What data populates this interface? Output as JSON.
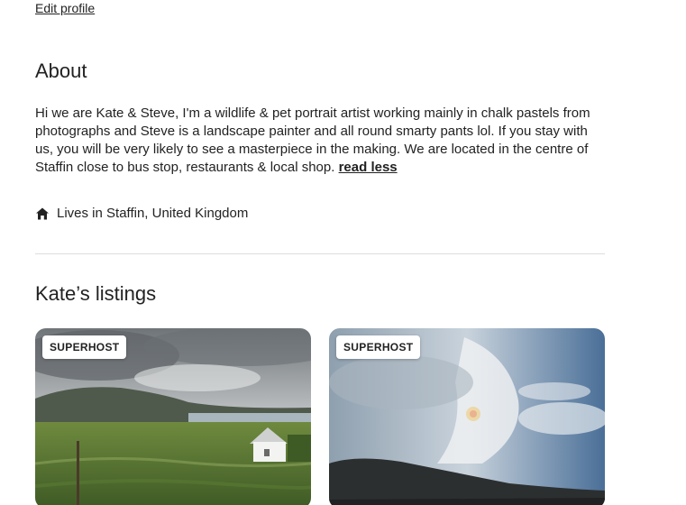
{
  "profile": {
    "edit_label": "Edit profile"
  },
  "about": {
    "heading": "About",
    "bio": "Hi we are Kate & Steve, I'm a wildlife & pet portrait artist working mainly in chalk pastels from photographs and Steve is a landscape painter and all round smarty pants lol. If you stay with us, you will be very likely to see a masterpiece in the making. We are located in the centre of Staffin close to bus stop, restaurants & local shop.",
    "read_less_label": "read less",
    "lives_in": "Lives in Staffin, United Kingdom",
    "lives_icon": "home-icon"
  },
  "listings": {
    "heading": "Kate’s listings",
    "items": [
      {
        "badge": "SUPERHOST",
        "photo": "landscape-white-house-hills"
      },
      {
        "badge": "SUPERHOST",
        "photo": "sky-clouds-cliff"
      }
    ]
  }
}
